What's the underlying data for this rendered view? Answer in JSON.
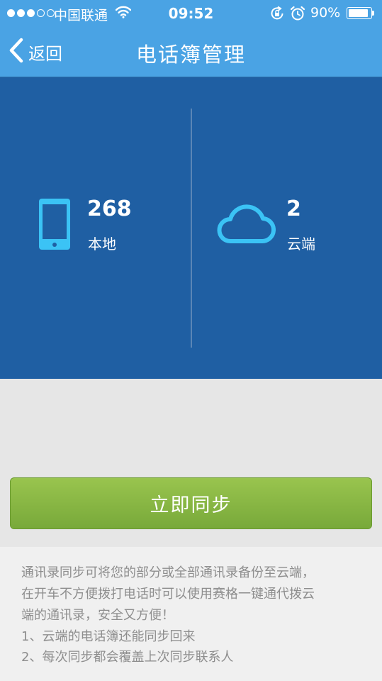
{
  "status_bar": {
    "carrier": "中国联通",
    "time": "09:52",
    "battery_percent": "90%",
    "battery_level": 0.9,
    "signal_bars_filled": 3,
    "signal_bars_total": 5
  },
  "nav": {
    "back_label": "返回",
    "title": "电话簿管理"
  },
  "stats": {
    "local_count": "268",
    "local_label": "本地",
    "cloud_count": "2",
    "cloud_label": "云端"
  },
  "sync_button_label": "立即同步",
  "description": {
    "line1": "通讯录同步可将您的部分或全部通讯录备份至云端，",
    "line2": "在开车不方便拨打电话时可以使用赛格一键通代拨云",
    "line3": "端的通讯录，安全又方便！",
    "line4": "1、云端的电话簿还能同步回来",
    "line5": "2、每次同步都会覆盖上次同步联系人"
  },
  "colors": {
    "nav_blue": "#4aa3e4",
    "panel_blue": "#1f5fa3",
    "icon_cyan": "#3bc3f5",
    "button_green": "#8bb845"
  },
  "icons": {
    "back": "chevron-left-icon",
    "wifi": "wifi-icon",
    "rotation_lock": "rotation-lock-icon",
    "alarm": "alarm-clock-icon",
    "battery": "battery-icon",
    "phone": "smartphone-icon",
    "cloud": "cloud-icon"
  }
}
